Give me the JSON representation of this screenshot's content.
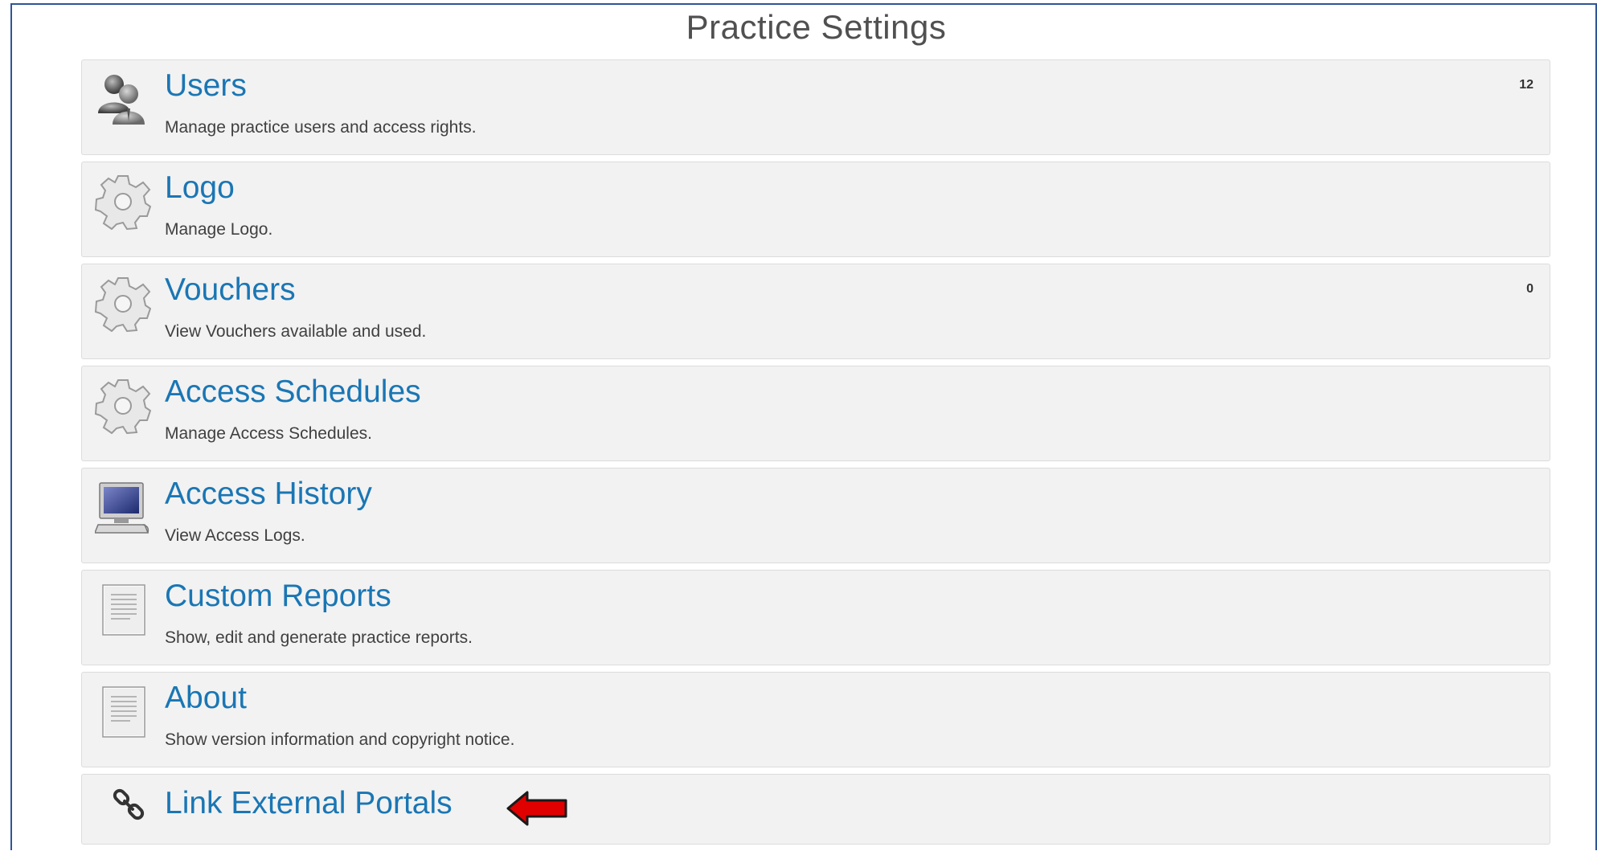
{
  "page": {
    "title": "Practice Settings"
  },
  "items": [
    {
      "title": "Users",
      "description": "Manage practice users and access rights.",
      "badge": "12",
      "icon": "users-icon"
    },
    {
      "title": "Logo",
      "description": "Manage Logo.",
      "badge": "",
      "icon": "gear-icon"
    },
    {
      "title": "Vouchers",
      "description": "View Vouchers available and used.",
      "badge": "0",
      "icon": "gear-icon"
    },
    {
      "title": "Access Schedules",
      "description": "Manage Access Schedules.",
      "badge": "",
      "icon": "gear-icon"
    },
    {
      "title": "Access History",
      "description": "View Access Logs.",
      "badge": "",
      "icon": "computer-icon"
    },
    {
      "title": "Custom Reports",
      "description": "Show, edit and generate practice reports.",
      "badge": "",
      "icon": "document-icon"
    },
    {
      "title": "About",
      "description": "Show version information and copyright notice.",
      "badge": "",
      "icon": "document-icon"
    },
    {
      "title": "Link External Portals",
      "description": "",
      "badge": "",
      "icon": "link-icon",
      "annotation": "red-arrow-icon"
    }
  ],
  "colors": {
    "title": "#1a76b4",
    "panel": "#f2f2f2",
    "frame_border": "#2f5597",
    "arrow": "#e00000"
  }
}
